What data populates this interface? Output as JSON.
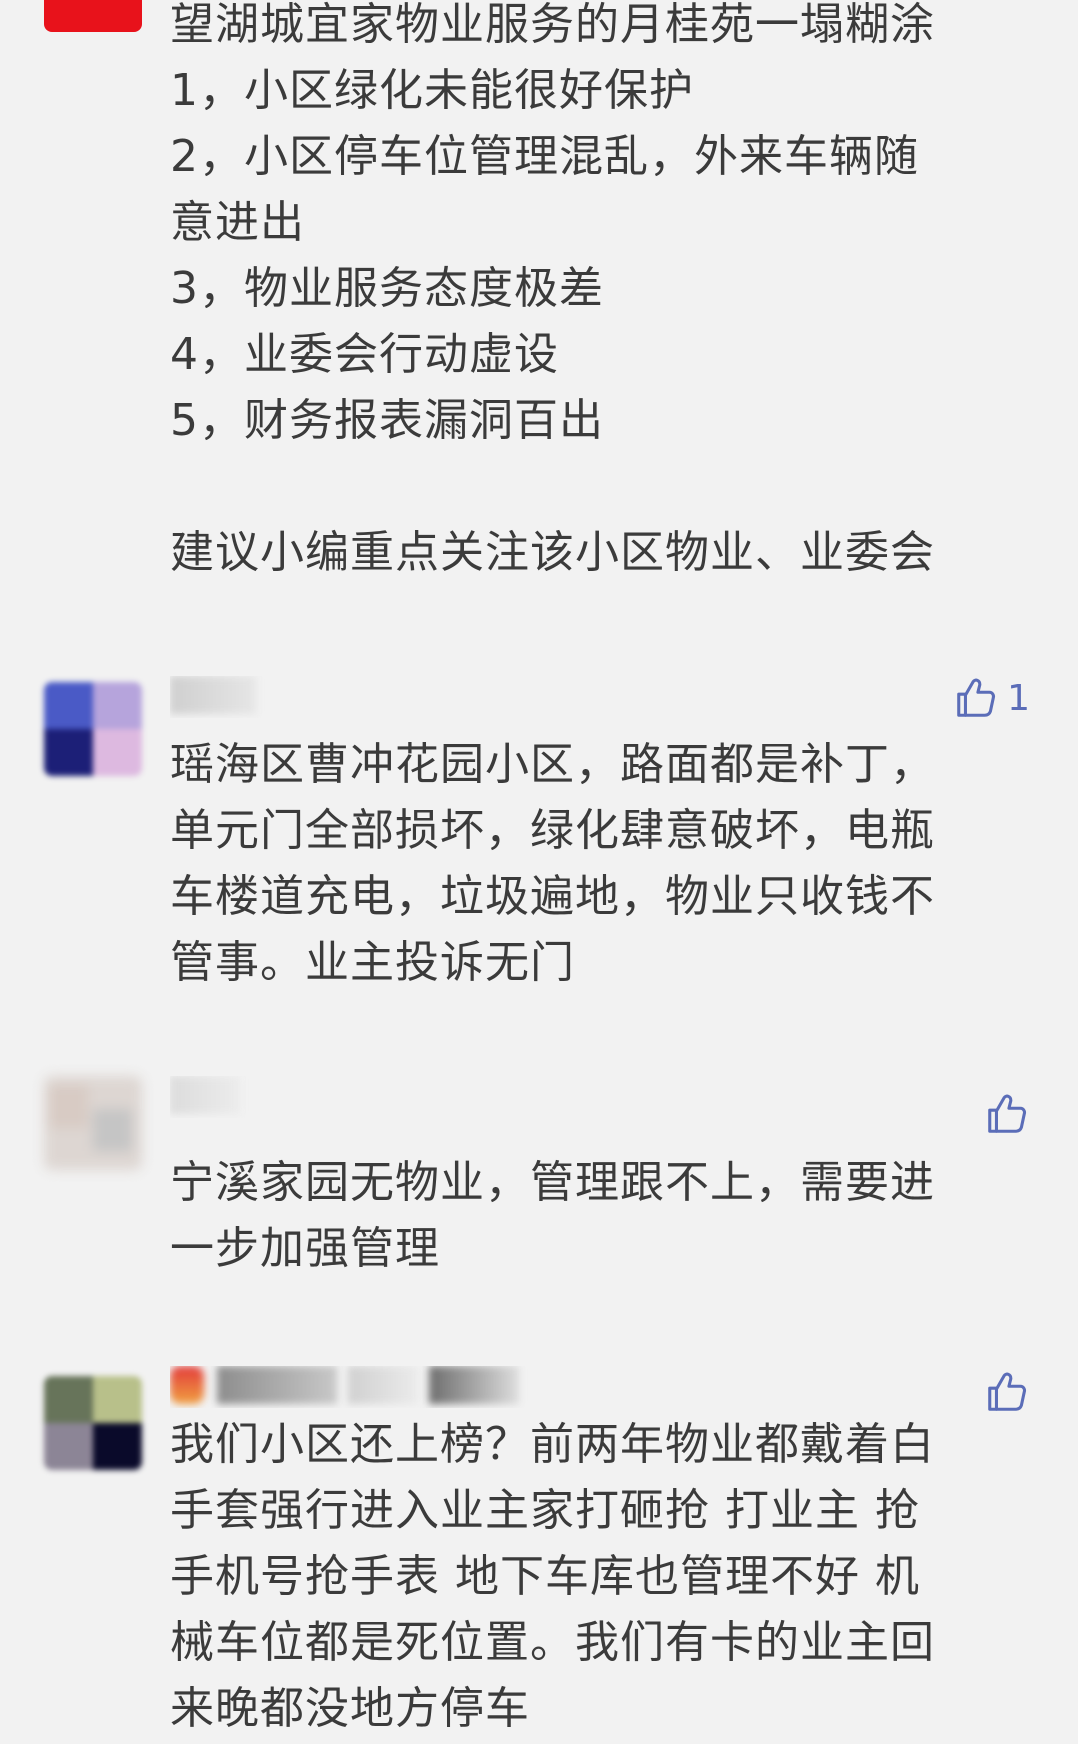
{
  "comments": [
    {
      "lines": [
        "望湖城宜家物业服务的月桂苑一塌糊涂",
        "1，小区绿化未能很好保护",
        "2，小区停车位管理混乱，外来车辆随",
        "意进出",
        "3，物业服务态度极差",
        "4，业委会行动虚设",
        "5，财务报表漏洞百出",
        "",
        "建议小编重点关注该小区物业、业委会"
      ]
    },
    {
      "like_count": "1",
      "lines": [
        "瑶海区曹冲花园小区，路面都是补丁，",
        "单元门全部损坏，绿化肆意破坏，电瓶",
        "车楼道充电，垃圾遍地，物业只收钱不",
        "管事。业主投诉无门"
      ]
    },
    {
      "lines": [
        "宁溪家园无物业，管理跟不上，需要进",
        "一步加强管理"
      ]
    },
    {
      "lines": [
        "我们小区还上榜？前两年物业都戴着白",
        "手套强行进入业主家打砸抢 打业主 抢",
        "手机号抢手表 地下车库也管理不好 机",
        "械车位都是死位置。我们有卡的业主回",
        "来晚都没地方停车"
      ]
    }
  ],
  "icons": {
    "like": "thumbs-up-icon",
    "avatar": "avatar-icon"
  },
  "colors": {
    "background": "#f2f2f2",
    "text": "#3b3b3b",
    "like_icon": "#5b6db8",
    "top_avatar": "#e8121b"
  }
}
